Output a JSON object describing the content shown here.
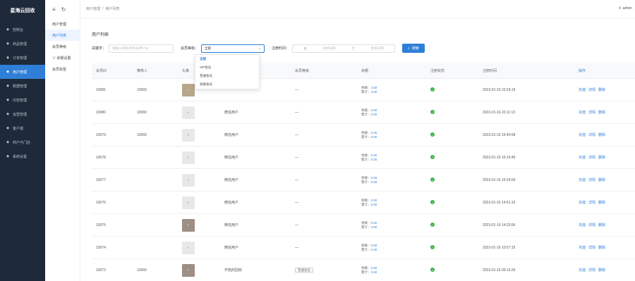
{
  "sidebar": {
    "logo": "星海云回收",
    "items": [
      {
        "label": "控制台",
        "icon": "home-icon"
      },
      {
        "label": "商品管理",
        "icon": "box-icon"
      },
      {
        "label": "订单管理",
        "icon": "order-icon"
      },
      {
        "label": "用户管理",
        "icon": "user-icon"
      },
      {
        "label": "数据管理",
        "icon": "chart-icon"
      },
      {
        "label": "内容管理",
        "icon": "doc-icon"
      },
      {
        "label": "运营管理",
        "icon": "ops-icon"
      },
      {
        "label": "客户端",
        "icon": "client-icon"
      },
      {
        "label": "商户与门店",
        "icon": "shop-icon"
      },
      {
        "label": "系统设置",
        "icon": "settings-icon"
      }
    ]
  },
  "submenu": {
    "title": "用户管理",
    "items": [
      "用户列表",
      "会员等级",
      "∨ 余额设置",
      "会员标签"
    ]
  },
  "topbar": {
    "breadcrumb": [
      "用户管理",
      "/",
      "用户列表"
    ],
    "user": "admin"
  },
  "page": {
    "title": "用户列表"
  },
  "filter": {
    "keyword_label": "关键字：",
    "keyword_placeholder": "请输入昵称/手机号/用户id",
    "level_label": "会员等级：",
    "level_value": "全部",
    "time_label": "注册时间：",
    "start_placeholder": "开始日期",
    "range_sep": "至",
    "end_placeholder": "结束日期",
    "search_label": "搜索"
  },
  "dropdown": {
    "options": [
      "全部",
      "VIP会员",
      "普通会员",
      "高级会员"
    ]
  },
  "table": {
    "headers": [
      "会员ID",
      "推荐人",
      "头像",
      "昵称",
      "会员等级",
      "余额",
      "注册状态",
      "注册时间",
      "操作"
    ],
    "rows": [
      {
        "id": "10081",
        "ref": "10060",
        "nick": "",
        "sub": "",
        "level": "—",
        "bal": "4.00",
        "total": "4.00",
        "time": "2023-01-16 22:24:19",
        "ops": [
          "充值",
          "详情",
          "删除"
        ]
      },
      {
        "id": "10080",
        "ref": "10060",
        "nick": "微信用户",
        "sub": "",
        "level": "—",
        "bal": "0.00",
        "total": "0.00",
        "time": "2023-01-16 22:11:13",
        "ops": [
          "充值",
          "详情",
          "删除"
        ]
      },
      {
        "id": "10079",
        "ref": "10060",
        "nick": "微信用户",
        "sub": "",
        "level": "—",
        "bal": "0.00",
        "total": "0.00",
        "time": "2023-01-16 15:40:58",
        "ops": [
          "充值",
          "详情",
          "删除"
        ]
      },
      {
        "id": "10078",
        "ref": "",
        "nick": "微信用户",
        "sub": "",
        "level": "—",
        "bal": "0.00",
        "total": "0.00",
        "time": "2023-01-16 15:16:45",
        "ops": [
          "充值",
          "详情",
          "删除"
        ]
      },
      {
        "id": "10077",
        "ref": "",
        "nick": "微信用户",
        "sub": "",
        "level": "—",
        "bal": "0.00",
        "total": "0.00",
        "time": "2023-01-16 15:24:59",
        "ops": [
          "充值",
          "详情",
          "删除"
        ]
      },
      {
        "id": "10076",
        "ref": "",
        "nick": "微信用户",
        "sub": "",
        "level": "—",
        "bal": "0.00",
        "total": "0.00",
        "time": "2023-01-16 14:51:15",
        "ops": [
          "充值",
          "详情",
          "删除"
        ]
      },
      {
        "id": "10075",
        "ref": "",
        "nick": "微信用户",
        "sub": "",
        "level": "—",
        "bal": "0.00",
        "total": "0.00",
        "time": "2023-01-16 14:23:56",
        "ops": [
          "充值",
          "详情",
          "删除"
        ]
      },
      {
        "id": "10074",
        "ref": "",
        "nick": "微信用户",
        "sub": "",
        "level": "—",
        "bal": "0.00",
        "total": "0.00",
        "time": "2023-01-16 10:57:15",
        "ops": [
          "充值",
          "详情",
          "删除"
        ]
      },
      {
        "id": "10073",
        "ref": "10060",
        "nick": "开拓的回收",
        "sub": "",
        "level": "普通会员",
        "bal": "0.00",
        "total": "0.00",
        "time": "2023-01-16 09:15:26",
        "ops": [
          "充值",
          "详情",
          "删除"
        ]
      }
    ],
    "balance_label": "余额：",
    "total_label": "累计："
  }
}
